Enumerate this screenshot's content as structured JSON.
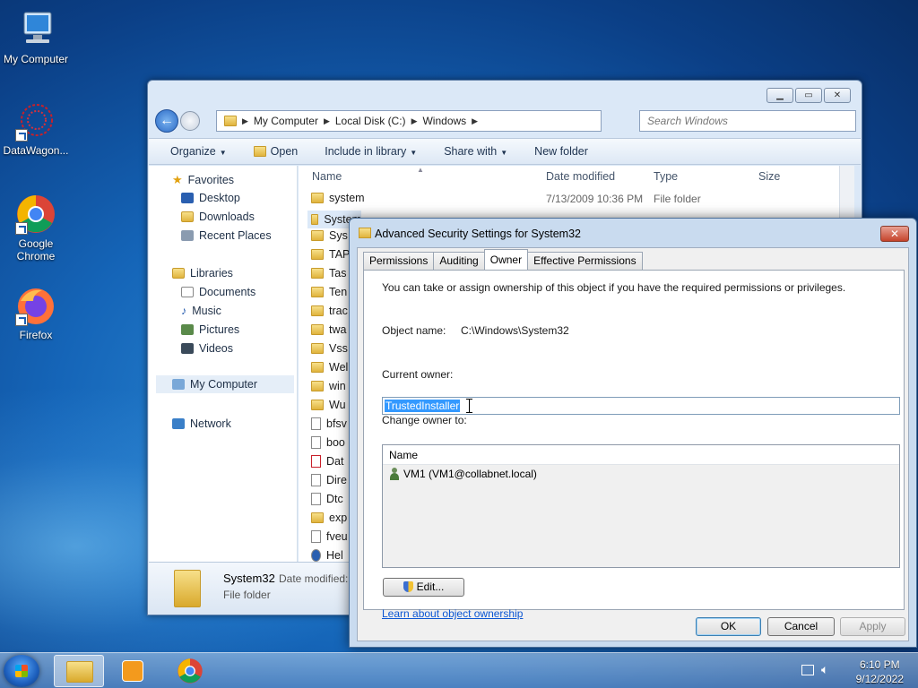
{
  "desktop": {
    "icons": [
      {
        "label": "My Computer"
      },
      {
        "label": "DataWagon..."
      },
      {
        "label": "Google Chrome"
      },
      {
        "label": "Firefox"
      }
    ]
  },
  "explorer": {
    "breadcrumb": [
      "My Computer",
      "Local Disk (C:)",
      "Windows"
    ],
    "search_placeholder": "Search Windows",
    "toolbar": {
      "organize": "Organize",
      "open": "Open",
      "include": "Include in library",
      "share": "Share with",
      "new_folder": "New folder"
    },
    "nav": {
      "favorites": "Favorites",
      "desktop": "Desktop",
      "downloads": "Downloads",
      "recent": "Recent Places",
      "libraries": "Libraries",
      "documents": "Documents",
      "music": "Music",
      "pictures": "Pictures",
      "videos": "Videos",
      "computer": "My Computer",
      "network": "Network"
    },
    "columns": {
      "name": "Name",
      "date": "Date modified",
      "type": "Type",
      "size": "Size"
    },
    "first_row": {
      "name": "system",
      "date": "7/13/2009 10:36 PM",
      "type": "File folder"
    },
    "rows": [
      "System",
      "Sys",
      "TAP",
      "Tas",
      "Ten",
      "trac",
      "twa",
      "Vss",
      "Wel",
      "win",
      "Wu",
      "bfsv",
      "boo",
      "Dat",
      "Dire",
      "Dtc",
      "exp",
      "fveu",
      "Hel"
    ],
    "details": {
      "name": "System32",
      "date_label": "Date modified:",
      "type": "File folder"
    }
  },
  "dialog": {
    "title": "Advanced Security Settings for System32",
    "close": "✕",
    "tabs": [
      "Permissions",
      "Auditing",
      "Owner",
      "Effective Permissions"
    ],
    "info": "You can take or assign ownership of this object if you have the required permissions or privileges.",
    "object_label": "Object name:",
    "object_value": "C:\\Windows\\System32",
    "current_owner_label": "Current owner:",
    "current_owner_value": "TrustedInstaller",
    "change_owner_label": "Change owner to:",
    "list_header": "Name",
    "list_item": "VM1 (VM1@collabnet.local)",
    "edit": "Edit...",
    "learn_link": "Learn about object ownership",
    "ok": "OK",
    "cancel": "Cancel",
    "apply": "Apply"
  },
  "taskbar": {
    "time": "6:10 PM",
    "date": "9/12/2022"
  }
}
